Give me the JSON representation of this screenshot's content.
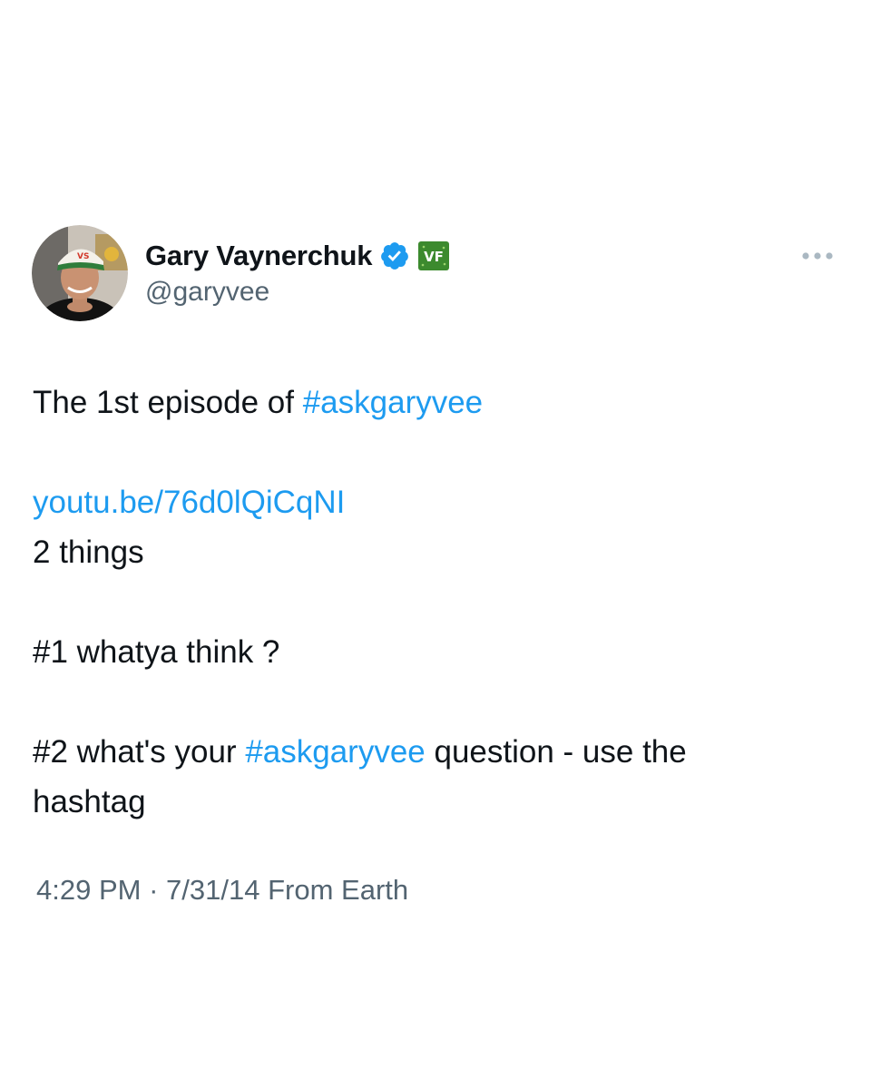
{
  "author": {
    "display_name": "Gary Vaynerchuk",
    "handle": "@garyvee",
    "verified_icon": "verified-check-icon",
    "affiliate_badge_text": "VF",
    "avatar_icon": "profile-avatar",
    "colors": {
      "verified": "#1d9bf0",
      "affiliate_badge": "#3c8a2e"
    }
  },
  "more_icon": "more-horizontal-icon",
  "tweet": {
    "line1_text": "The 1st episode of ",
    "line1_hashtag": "#askgaryvee",
    "link": "youtu.be/76d0lQiCqNI",
    "line3": "2 things",
    "line4": "#1 whatya think ?",
    "line5_text": "#2 what's your ",
    "line5_hashtag": "#askgaryvee",
    "line5_tail": " question - use the",
    "line6": "hashtag"
  },
  "meta": {
    "time": "4:29 PM",
    "separator": "·",
    "date": "7/31/14",
    "source": "From Earth"
  },
  "colors": {
    "text": "#0f1419",
    "secondary": "#536471",
    "link": "#1d9bf0",
    "background": "#ffffff"
  }
}
